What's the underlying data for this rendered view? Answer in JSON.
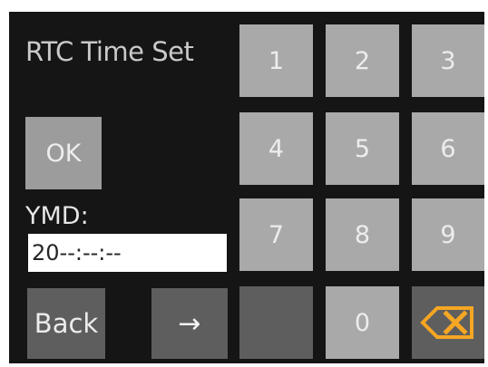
{
  "title": "RTC Time Set",
  "ok_label": "OK",
  "ymd_label": "YMD:",
  "ymd_value": "20--:--:--",
  "back_label": "Back",
  "next_symbol": "→",
  "keypad": {
    "k1": "1",
    "k2": "2",
    "k3": "3",
    "k4": "4",
    "k5": "5",
    "k6": "6",
    "k7": "7",
    "k8": "8",
    "k9": "9",
    "k0": "0"
  },
  "icons": {
    "next": "arrow-right-icon",
    "delete": "backspace-icon"
  },
  "colors": {
    "screen_background": "#151515",
    "key_light": "#a9a9a9",
    "key_dark": "#5e5e5e",
    "accent_orange": "#f5a623",
    "input_background": "#ffffff"
  }
}
